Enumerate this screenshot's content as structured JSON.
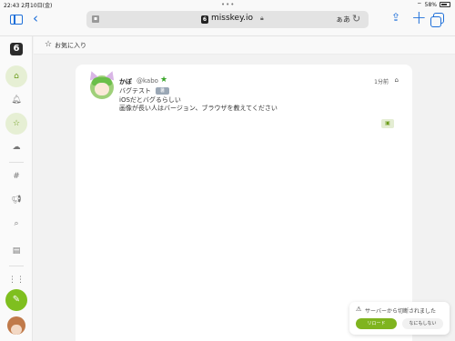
{
  "status_bar": {
    "time_date": "22:43 2月10日(金)",
    "dots": "•••",
    "battery": "58%"
  },
  "browser": {
    "url": "misskey.io",
    "site_icon": "6",
    "aa_label": "ぁあ",
    "icons": {
      "sidebar": "sidebar-icon",
      "back": "chevron-left-icon",
      "reload": "reload-icon",
      "share": "share-icon",
      "new_tab": "plus-icon",
      "tabs": "tabs-icon",
      "lock": "lock-icon"
    }
  },
  "nav": {
    "logo": "6",
    "items": [
      "home-icon",
      "bell-icon",
      "star-icon",
      "cloud-icon",
      "hash-icon",
      "megaphone-icon",
      "search-icon",
      "drive-icon",
      "grid-icon"
    ],
    "active_items": [
      "home-icon",
      "star-icon"
    ],
    "compose_icon": "pencil-icon"
  },
  "column": {
    "title": "お気に入り",
    "icon": "star-icon"
  },
  "note": {
    "display_name": "かぼ",
    "username": "@kabo",
    "time": "1分前",
    "subtitle": "バグテスト",
    "chip": "暑",
    "lines": [
      "iOSだとバグるらしい",
      "画像が長い人はバージョン、ブラウザを教えてください"
    ]
  },
  "toast": {
    "message": "サーバーから切断されました",
    "reload": "リロード",
    "ignore": "なにもしない"
  },
  "colors": {
    "accent": "#7fbf1f",
    "link": "#1e6fd9"
  }
}
